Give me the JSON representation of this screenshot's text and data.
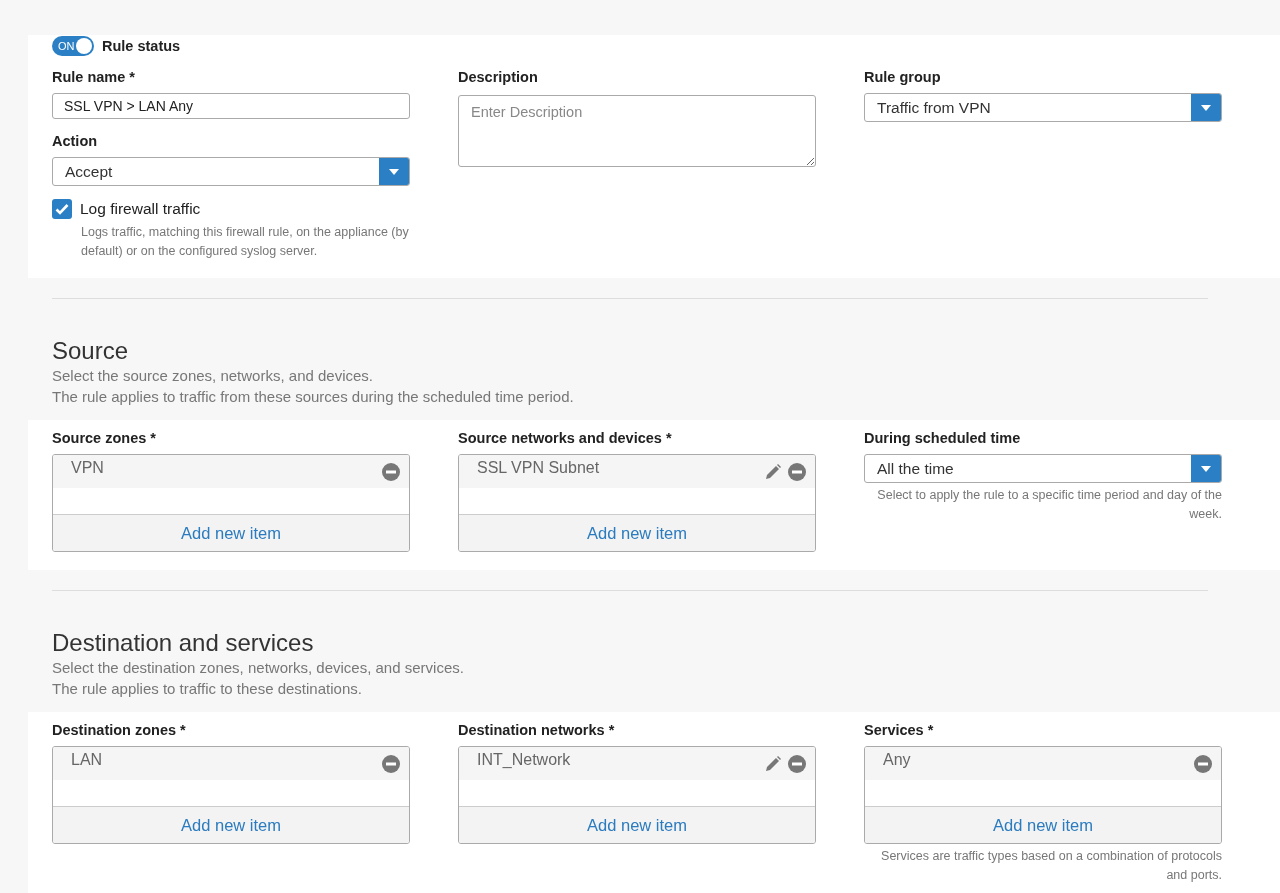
{
  "general": {
    "rule_status": {
      "label": "ON",
      "on": true,
      "caption": "Rule status"
    },
    "rule_name": {
      "label": "Rule name *",
      "value": "SSL VPN > LAN Any"
    },
    "action": {
      "label": "Action",
      "value": "Accept"
    },
    "log_traffic": {
      "label": "Log firewall traffic",
      "checked": true,
      "help": "Logs traffic, matching this firewall rule, on the appliance (by default) or on the configured syslog server."
    },
    "description": {
      "label": "Description",
      "placeholder": "Enter Description"
    },
    "rule_group": {
      "label": "Rule group",
      "value": "Traffic from VPN"
    }
  },
  "sections": [
    {
      "title": "Source",
      "lines": [
        "Select the source zones, networks, and devices.",
        "The rule applies to traffic from these sources during the scheduled time period."
      ],
      "fields": [
        {
          "kind": "list",
          "label": "Source zones *",
          "items": [
            {
              "text": "VPN",
              "editable": false
            }
          ],
          "add_label": "Add new item"
        },
        {
          "kind": "list",
          "label": "Source networks and devices *",
          "items": [
            {
              "text": "SSL VPN Subnet",
              "editable": true
            }
          ],
          "add_label": "Add new item"
        },
        {
          "kind": "select",
          "label": "During scheduled time",
          "value": "All the time",
          "help": "Select to apply the rule to a specific time period and day of the week."
        }
      ]
    },
    {
      "title": "Destination and services",
      "lines": [
        "Select the destination zones, networks, devices, and services.",
        "The rule applies to traffic to these destinations."
      ],
      "fields": [
        {
          "kind": "list",
          "label": "Destination zones *",
          "items": [
            {
              "text": "LAN",
              "editable": false
            }
          ],
          "add_label": "Add new item"
        },
        {
          "kind": "list",
          "label": "Destination networks *",
          "items": [
            {
              "text": "INT_Network",
              "editable": true
            }
          ],
          "add_label": "Add new item"
        },
        {
          "kind": "list",
          "label": "Services *",
          "items": [
            {
              "text": "Any",
              "editable": false
            }
          ],
          "add_label": "Add new item",
          "help": "Services are traffic types based on a combination of protocols and ports."
        }
      ]
    }
  ]
}
